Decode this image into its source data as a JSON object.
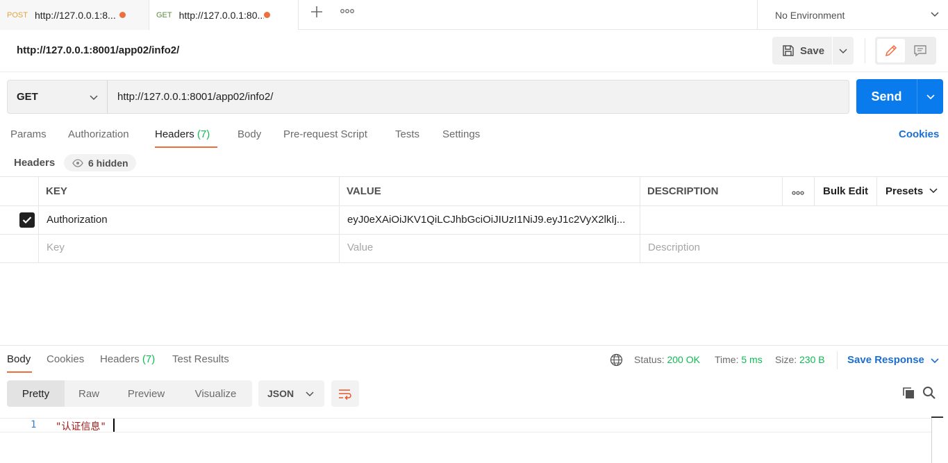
{
  "tabs": [
    {
      "method": "POST",
      "title": "http://127.0.0.1:8001/app01/login/",
      "display": "http://127.0.0.1:8..."
    },
    {
      "method": "GET",
      "title": "http://127.0.0.1:8001/app02/info2/",
      "display": "http://127.0.0.1:80..."
    }
  ],
  "environment": "No Environment",
  "request": {
    "title": "http://127.0.0.1:8001/app02/info2/",
    "method": "GET",
    "url": "http://127.0.0.1:8001/app02/info2/",
    "save_label": "Save",
    "send_label": "Send"
  },
  "request_tabs": {
    "params": "Params",
    "authorization": "Authorization",
    "headers": "Headers",
    "headers_count": "(7)",
    "body": "Body",
    "pre_request": "Pre-request Script",
    "tests": "Tests",
    "settings": "Settings",
    "cookies": "Cookies"
  },
  "headers_section": {
    "label": "Headers",
    "hidden": "6 hidden",
    "columns": {
      "key": "KEY",
      "value": "VALUE",
      "description": "DESCRIPTION",
      "bulk_edit": "Bulk Edit",
      "presets": "Presets"
    },
    "rows": [
      {
        "checked": true,
        "key": "Authorization",
        "value": "eyJ0eXAiOiJKV1QiLCJhbGciOiJIUzI1NiJ9.eyJ1c2VyX2lkIj...",
        "description": ""
      }
    ],
    "placeholders": {
      "key": "Key",
      "value": "Value",
      "description": "Description"
    }
  },
  "response": {
    "tabs": {
      "body": "Body",
      "cookies": "Cookies",
      "headers": "Headers",
      "headers_count": "(7)",
      "test_results": "Test Results"
    },
    "status_label": "Status:",
    "status_value": "200 OK",
    "time_label": "Time:",
    "time_value": "5 ms",
    "size_label": "Size:",
    "size_value": "230 B",
    "save_response": "Save Response",
    "views": [
      "Pretty",
      "Raw",
      "Preview",
      "Visualize"
    ],
    "format": "JSON",
    "lines": [
      {
        "num": "1",
        "text": "\"认证信息\""
      }
    ]
  },
  "colors": {
    "accent": "#f26b3a",
    "send": "#097bed",
    "link": "#1c6fd1",
    "success": "#0cbb52"
  }
}
